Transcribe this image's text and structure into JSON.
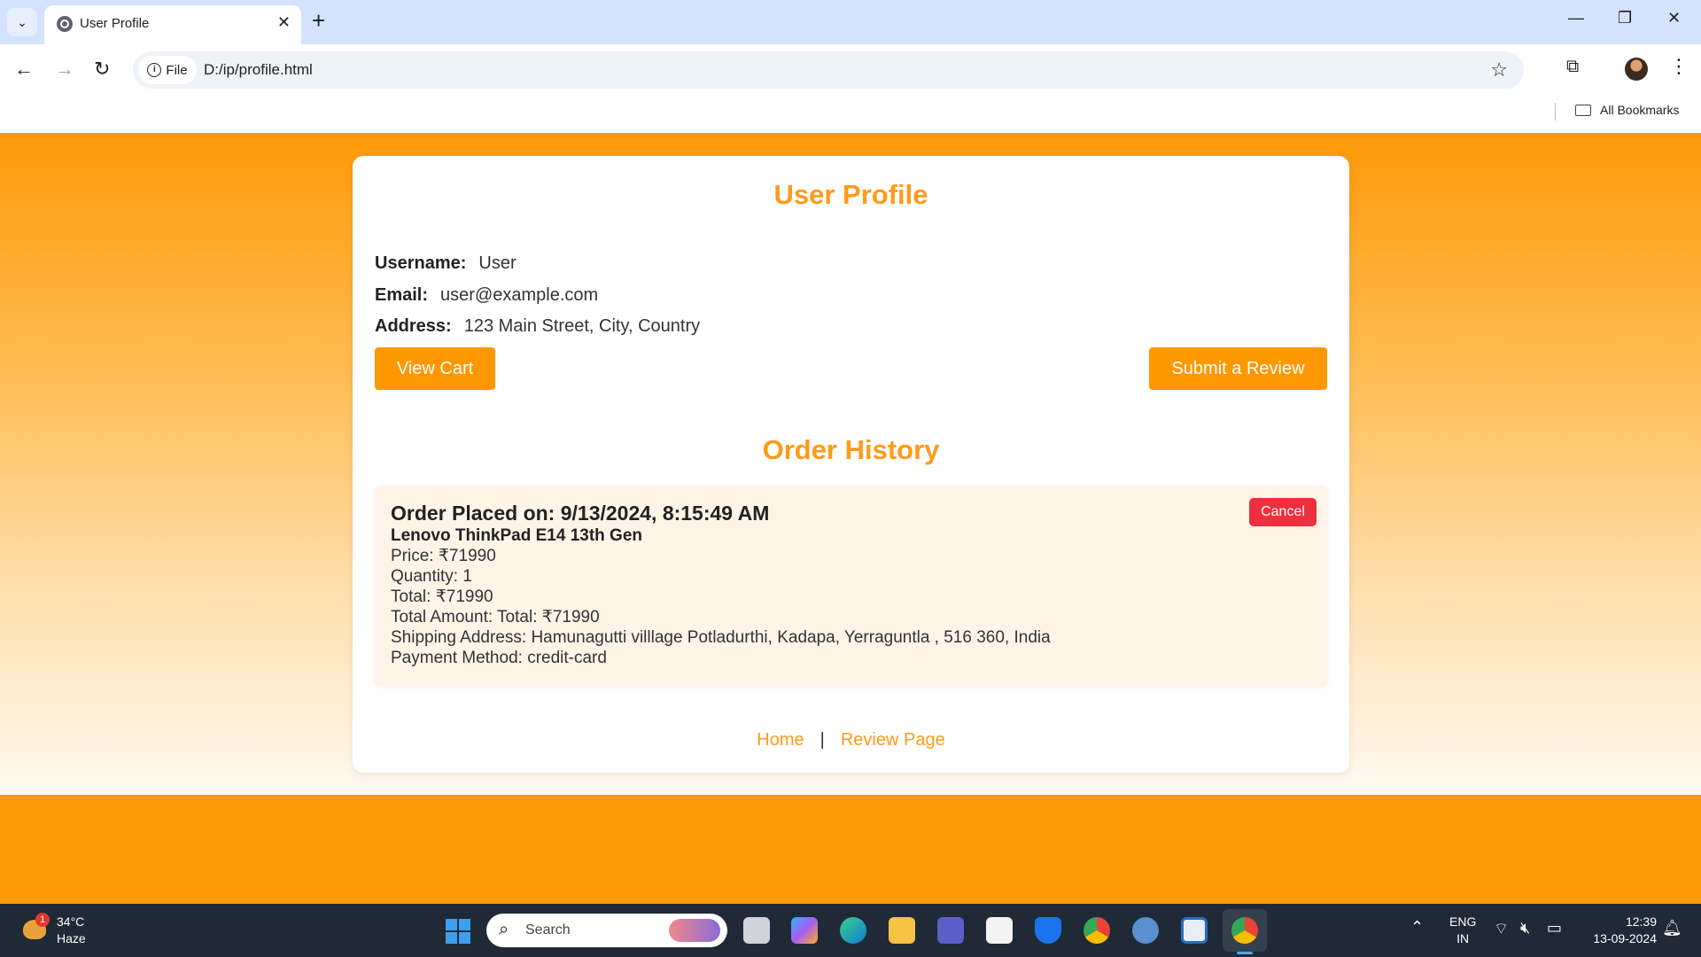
{
  "browser": {
    "tab_title": "User Profile",
    "close_glyph": "✕",
    "newtab_glyph": "+",
    "url_chip": "File",
    "url": "D:/ip/profile.html",
    "bookmarks_label": "All Bookmarks",
    "icons": [
      "tab-list-icon",
      "globe-icon",
      "back-icon",
      "forward-icon",
      "reload-icon",
      "info-icon",
      "star-icon",
      "extensions-icon",
      "profile-avatar",
      "more-menu-icon",
      "folder-icon"
    ]
  },
  "profile": {
    "title": "User Profile",
    "username_label": "Username:",
    "username": "User",
    "email_label": "Email:",
    "email": "user@example.com",
    "address_label": "Address:",
    "address": "123 Main Street, City, Country",
    "view_cart_label": "View Cart",
    "review_label": "Submit a Review",
    "accent_color": "#ff9800"
  },
  "orders": {
    "title": "Order History",
    "items": [
      {
        "placed": "Order Placed on: 9/13/2024, 8:15:49 AM",
        "product": "Lenovo ThinkPad E14 13th Gen",
        "price": "Price: ₹71990",
        "quantity": "Quantity: 1",
        "total": "Total: ₹71990",
        "total_amount": "Total Amount: Total: ₹71990",
        "shipping": "Shipping Address: Hamunagutti villlage Potladurthi, Kadapa, Yerraguntla , 516 360, India",
        "payment": "Payment Method: credit-card",
        "cancel_label": "Cancel"
      }
    ]
  },
  "footer": {
    "home": "Home",
    "separator": "|",
    "review_page": "Review Page"
  },
  "taskbar": {
    "weather_badge": "1",
    "temperature": "34°C",
    "condition": "Haze",
    "search_label": "Search",
    "lang_line1": "ENG",
    "lang_line2": "IN",
    "time": "12:39",
    "date": "13-09-2024"
  }
}
